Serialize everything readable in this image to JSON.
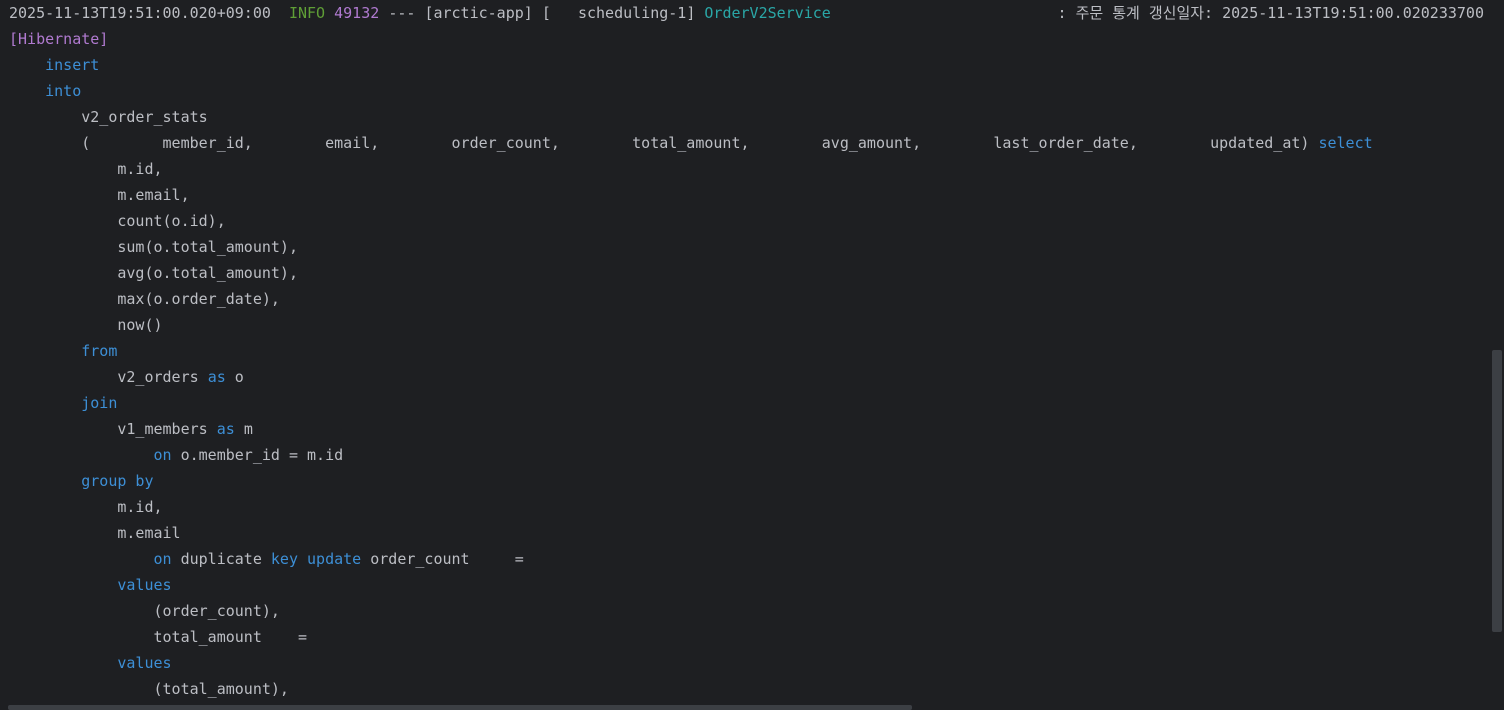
{
  "log": {
    "timestamp": "2025-11-13T19:51:00.020+09:00",
    "level": "INFO",
    "pid": "49132",
    "separator": "---",
    "app": "[arctic-app]",
    "thread": "[   scheduling-1]",
    "logger": "OrderV2Service",
    "message": ": 주문 통계 갱신일자: 2025-11-13T19:51:00.020233700",
    "tag": "[Hibernate]"
  },
  "sql": {
    "insert": "insert",
    "into": "into",
    "table": "v2_order_stats",
    "columns": "(        member_id,        email,        order_count,        total_amount,        avg_amount,        last_order_date,        updated_at)",
    "select": "select",
    "select_items": [
      "m.id,",
      "m.email,",
      "count(o.id),",
      "sum(o.total_amount),",
      "avg(o.total_amount),",
      "max(o.order_date),",
      "now()"
    ],
    "from": "from",
    "from_table": "v2_orders",
    "as": "as",
    "alias_o": "o",
    "join": "join",
    "join_table": "v1_members",
    "alias_m": "m",
    "on": "on",
    "join_cond": "o.member_id = m.id",
    "group_by": "group by",
    "group_items": [
      "m.id,",
      "m.email"
    ],
    "duplicate": "duplicate",
    "key": "key",
    "update": "update",
    "order_count_assign": "order_count     =",
    "values": "values",
    "order_count_val": "(order_count),",
    "total_amount_assign": "total_amount    =",
    "total_amount_val": "(total_amount),"
  },
  "colors": {
    "background": "#1e1f22",
    "text": "#bcbec4",
    "info": "#5f9e36",
    "pid_and_tag": "#b07ad0",
    "logger": "#2aa7a7",
    "keyword": "#3d8fd6"
  }
}
